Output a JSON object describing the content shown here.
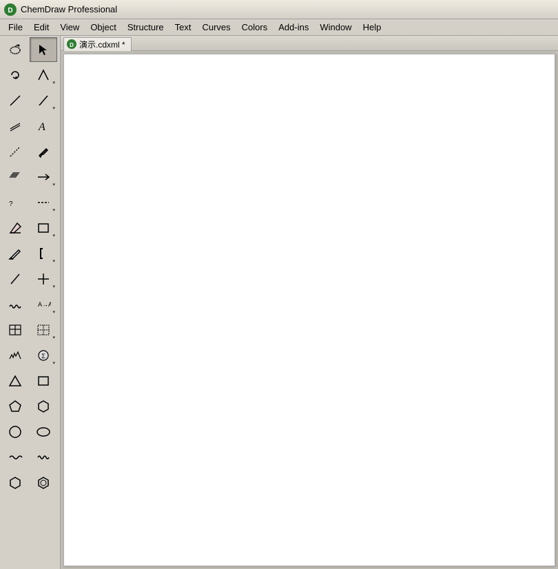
{
  "titleBar": {
    "appName": "ChemDraw Professional"
  },
  "menuBar": {
    "items": [
      "File",
      "Edit",
      "View",
      "Object",
      "Structure",
      "Text",
      "Curves",
      "Colors",
      "Add-ins",
      "Window",
      "Help"
    ]
  },
  "docTab": {
    "label": "演示.cdxml *"
  },
  "toolbar": {
    "rows": [
      [
        {
          "name": "lasso-tool",
          "icon": "lasso",
          "active": false
        },
        {
          "name": "select-tool",
          "icon": "select",
          "active": true
        }
      ],
      [
        {
          "name": "rotate-tool",
          "icon": "rotate",
          "active": false
        },
        {
          "name": "bond-tool",
          "icon": "bond-angle",
          "active": false,
          "sub": true
        }
      ],
      [
        {
          "name": "bond-single",
          "icon": "bond-line",
          "active": false
        },
        {
          "name": "bond-bold",
          "icon": "bond-bold",
          "active": false,
          "sub": true
        }
      ],
      [
        {
          "name": "bond-multi",
          "icon": "bond-multi",
          "active": false
        },
        {
          "name": "text-tool",
          "icon": "text-A",
          "active": false
        }
      ],
      [
        {
          "name": "bond-dash",
          "icon": "bond-dash",
          "active": false
        },
        {
          "name": "pen-tool",
          "icon": "pen",
          "active": false
        }
      ],
      [
        {
          "name": "bond-lines",
          "icon": "bond-lines",
          "active": false
        },
        {
          "name": "arrow-tool",
          "icon": "arrow",
          "active": false,
          "sub": true
        }
      ],
      [
        {
          "name": "bond-wedge",
          "icon": "bond-wedge",
          "active": false
        },
        {
          "name": "unknown1",
          "icon": "dot-line",
          "active": false,
          "sub": true
        }
      ],
      [
        {
          "name": "eraser-tool",
          "icon": "eraser",
          "active": false
        },
        {
          "name": "rectangle-tool",
          "icon": "rectangle",
          "active": false,
          "sub": true
        }
      ],
      [
        {
          "name": "pencil-tool",
          "icon": "pencil",
          "active": false
        },
        {
          "name": "bracket-tool",
          "icon": "bracket",
          "active": false,
          "sub": true
        }
      ],
      [
        {
          "name": "bond-tool2",
          "icon": "bond-slash",
          "active": false
        },
        {
          "name": "crosshair-tool",
          "icon": "crosshair",
          "active": false,
          "sub": true
        }
      ],
      [
        {
          "name": "wavy-bond",
          "icon": "wavy",
          "active": false
        },
        {
          "name": "atom-map",
          "icon": "atom-map",
          "active": false,
          "sub": true
        }
      ],
      [
        {
          "name": "table-tool",
          "icon": "table",
          "active": false
        },
        {
          "name": "dotted-table",
          "icon": "dotted-table",
          "active": false,
          "sub": true
        }
      ],
      [
        {
          "name": "spectroscopy",
          "icon": "spectro",
          "active": false
        },
        {
          "name": "stoichiometry",
          "icon": "stoich",
          "active": false,
          "sub": true
        }
      ],
      [
        {
          "name": "triangle",
          "icon": "triangle",
          "active": false
        },
        {
          "name": "shape-rect",
          "icon": "shape-rect",
          "active": false
        }
      ],
      [
        {
          "name": "pentagon",
          "icon": "pentagon",
          "active": false
        },
        {
          "name": "hexagon",
          "icon": "hexagon",
          "active": false
        }
      ],
      [
        {
          "name": "circle",
          "icon": "circle",
          "active": false
        },
        {
          "name": "ellipse",
          "icon": "ellipse",
          "active": false
        }
      ],
      [
        {
          "name": "wave-line",
          "icon": "wave",
          "active": false
        },
        {
          "name": "squiggle",
          "icon": "squiggle",
          "active": false
        }
      ],
      [
        {
          "name": "hex-ring",
          "icon": "hex-ring",
          "active": false
        },
        {
          "name": "benzene",
          "icon": "benzene",
          "active": false
        }
      ]
    ]
  }
}
